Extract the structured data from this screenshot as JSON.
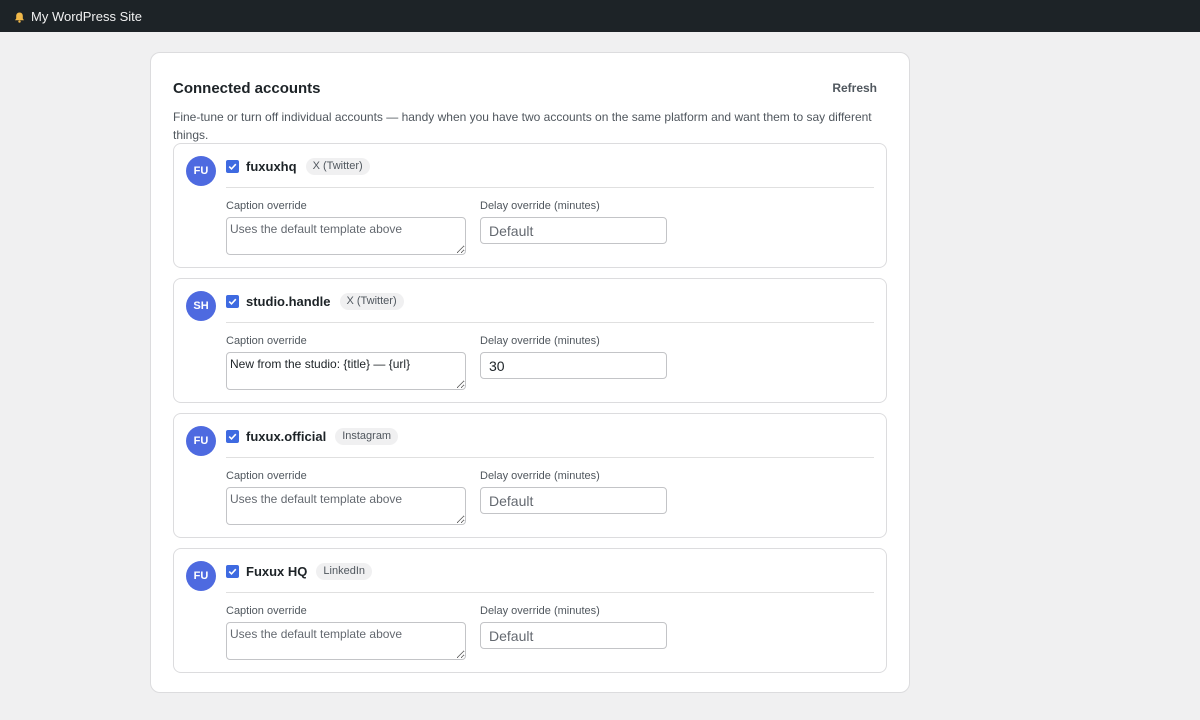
{
  "adminbar": {
    "site_name": "My WordPress Site",
    "icon": "bell-icon"
  },
  "panel": {
    "title": "Connected accounts",
    "refresh_label": "Refresh",
    "description": "Fine-tune or turn off individual accounts — handy when you have two accounts on the same platform and want them to say different things."
  },
  "labels": {
    "caption": "Caption override",
    "delay": "Delay override (minutes)"
  },
  "accounts": [
    {
      "initials": "FU",
      "name": "fuxuxhq",
      "platform": "X (Twitter)",
      "enabled": true,
      "caption_value": "",
      "caption_placeholder": "Uses the default template above",
      "delay_value": "",
      "delay_placeholder": "Default"
    },
    {
      "initials": "SH",
      "name": "studio.handle",
      "platform": "X (Twitter)",
      "enabled": true,
      "caption_value": "New from the studio: {title} — {url}",
      "caption_placeholder": "Uses the default template above",
      "delay_value": "30",
      "delay_placeholder": "Default"
    },
    {
      "initials": "FU",
      "name": "fuxux.official",
      "platform": "Instagram",
      "enabled": true,
      "caption_value": "",
      "caption_placeholder": "Uses the default template above",
      "delay_value": "",
      "delay_placeholder": "Default"
    },
    {
      "initials": "FU",
      "name": "Fuxux HQ",
      "platform": "LinkedIn",
      "enabled": true,
      "caption_value": "",
      "caption_placeholder": "Uses the default template above",
      "delay_value": "",
      "delay_placeholder": "Default"
    }
  ],
  "colors": {
    "adminbar_bg": "#1d2327",
    "accent": "#3e6ae1",
    "avatar_bg": "#4e6ae0",
    "bell": "#f0b849"
  }
}
